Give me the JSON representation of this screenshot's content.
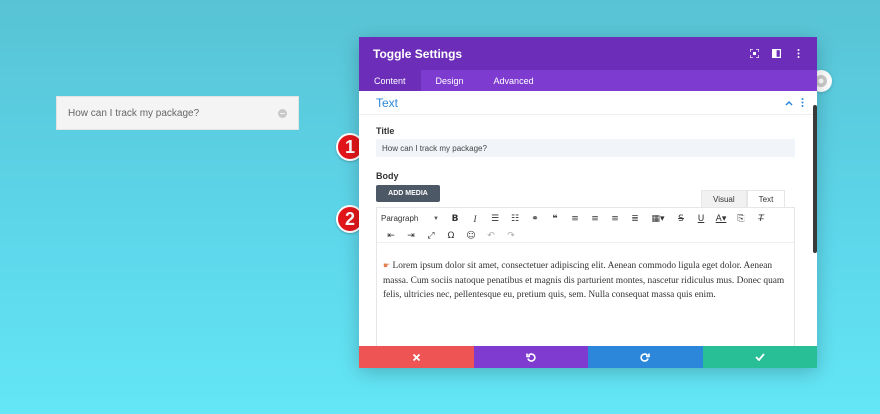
{
  "preview": {
    "toggle_title": "How can I track my package?",
    "toggle_icon": "minus-circle-icon"
  },
  "markers": [
    {
      "label": "1"
    },
    {
      "label": "2"
    }
  ],
  "modal": {
    "title": "Toggle Settings",
    "header_icons": [
      "fullscreen-icon",
      "columns-icon",
      "more-vertical-icon"
    ],
    "tabs": [
      {
        "label": "Content",
        "active": true
      },
      {
        "label": "Design",
        "active": false
      },
      {
        "label": "Advanced",
        "active": false
      }
    ],
    "section": {
      "title": "Text",
      "collapse_icon": "chevron-up-icon",
      "menu_icon": "more-vertical-icon"
    },
    "title_field": {
      "label": "Title",
      "value": "How can I track my package?"
    },
    "body_field": {
      "label": "Body",
      "add_media_label": "ADD MEDIA",
      "editor_tabs": [
        {
          "label": "Visual",
          "active": false
        },
        {
          "label": "Text",
          "active": true
        }
      ],
      "format_select": "Paragraph",
      "content": "Lorem ipsum dolor sit amet, consectetuer adipiscing elit. Aenean commodo ligula eget dolor. Aenean massa. Cum sociis natoque penatibus et magnis dis parturient montes, nascetur ridiculus mus. Donec quam felis, ultricies nec, pellentesque eu, pretium quis, sem. Nulla consequat massa quis enim."
    },
    "footer": [
      {
        "name": "cancel",
        "icon": "close-icon",
        "color": "#ef5455"
      },
      {
        "name": "undo",
        "icon": "undo-icon",
        "color": "#7f3bd0"
      },
      {
        "name": "redo",
        "icon": "redo-icon",
        "color": "#2c87da"
      },
      {
        "name": "save",
        "icon": "check-icon",
        "color": "#28bf97"
      }
    ]
  },
  "colors": {
    "header": "#6c2eb9",
    "tabs": "#7e3bd0",
    "accent": "#2b87da",
    "marker": "#e3161b"
  }
}
